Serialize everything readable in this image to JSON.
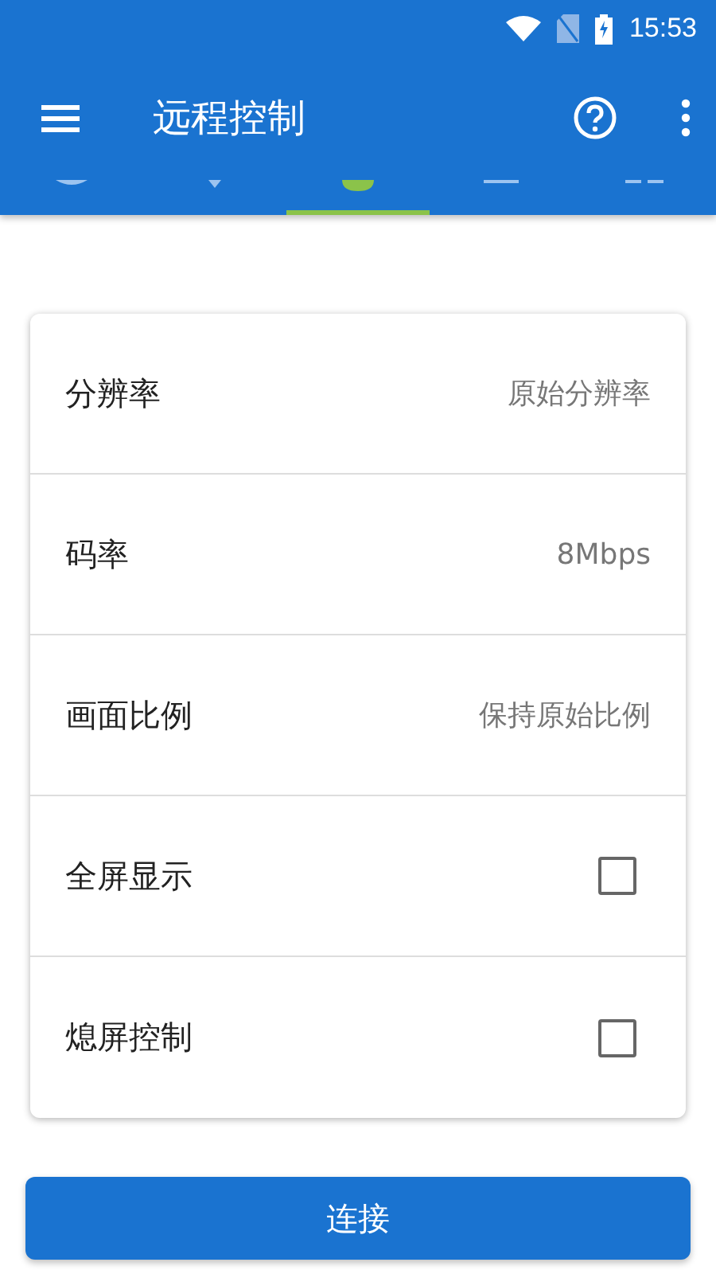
{
  "status_bar": {
    "time": "15:53"
  },
  "toolbar": {
    "title": "远程控制"
  },
  "tabs": [
    {
      "selected": false
    },
    {
      "selected": false
    },
    {
      "selected": true
    },
    {
      "selected": false
    },
    {
      "selected": false
    }
  ],
  "settings": [
    {
      "kind": "value",
      "label": "分辨率",
      "value": "原始分辨率"
    },
    {
      "kind": "value",
      "label": "码率",
      "value": "8Mbps"
    },
    {
      "kind": "value",
      "label": "画面比例",
      "value": "保持原始比例"
    },
    {
      "kind": "checkbox",
      "label": "全屏显示",
      "checked": false
    },
    {
      "kind": "checkbox",
      "label": "熄屏控制",
      "checked": false
    }
  ],
  "connect_button": {
    "label": "连接"
  }
}
